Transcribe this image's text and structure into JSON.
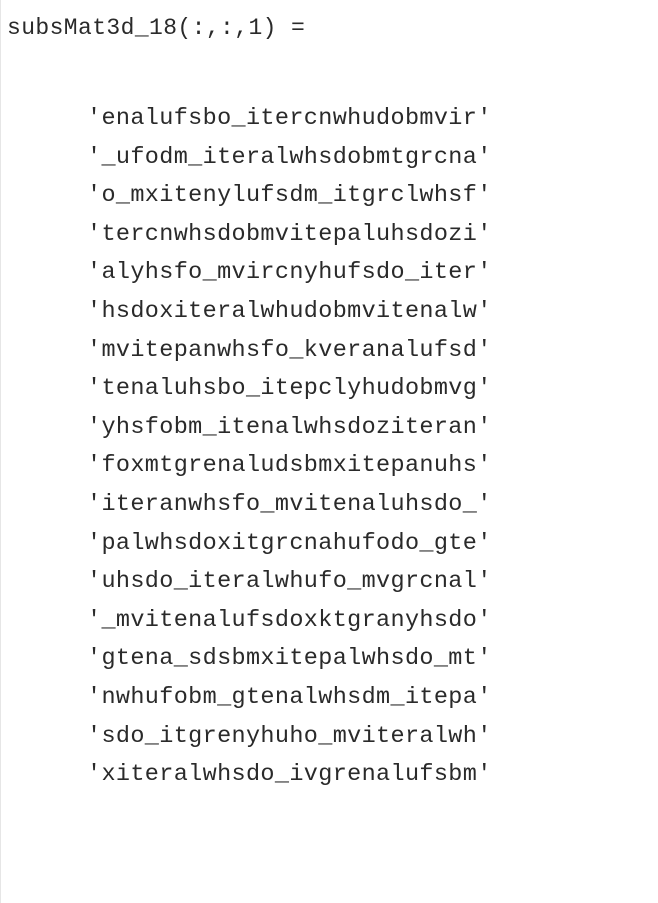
{
  "console": {
    "header": "subsMat3d_18(:,:,1) =",
    "rows": [
      "'enalufsbo_itercnwhudobmvir'",
      "'_ufodm_iteralwhsdobmtgrcna'",
      "'o_mxitenylufsdm_itgrclwhsf'",
      "'tercnwhsdobmvitepaluhsdozi'",
      "'alyhsfo_mvircnyhufsdo_iter'",
      "'hsdoxiteralwhudobmvitenalw'",
      "'mvitepanwhsfo_kveranalufsd'",
      "'tenaluhsbo_itepclyhudobmvg'",
      "'yhsfobm_itenalwhsdoziteran'",
      "'foxmtgrenaludsbmxitepanuhs'",
      "'iteranwhsfo_mvitenaluhsdo_'",
      "'palwhsdoxitgrcnahufodo_gte'",
      "'uhsdo_iteralwhufo_mvgrcnal'",
      "'_mvitenalufsdoxktgranyhsdo'",
      "'gtena_sdsbmxitepalwhsdo_mt'",
      "'nwhufobm_gtenalwhsdm_itepa'",
      "'sdo_itgrenyhuho_mviteralwh'",
      "'xiteralwhsdo_ivgrenalufsbm'"
    ]
  }
}
